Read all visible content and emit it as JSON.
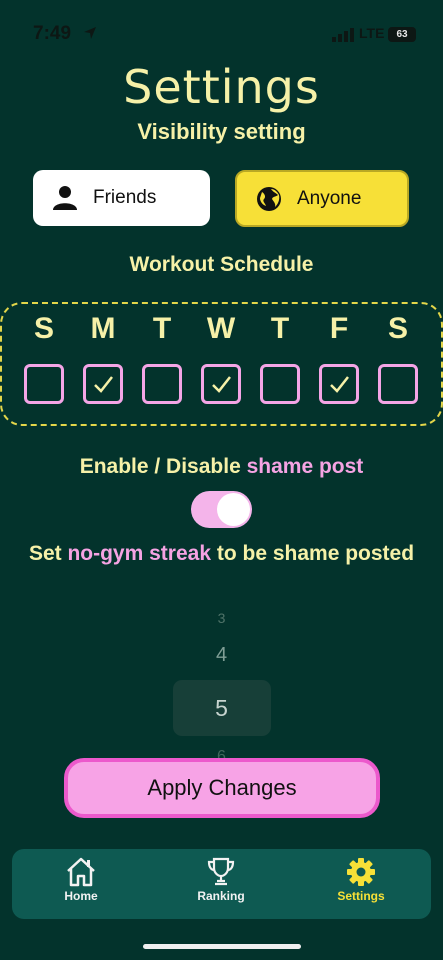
{
  "status": {
    "time": "7:49",
    "network": "LTE",
    "battery": "63"
  },
  "header": {
    "title": "Settings",
    "subtitle": "Visibility setting"
  },
  "visibility": {
    "friends_label": "Friends",
    "anyone_label": "Anyone",
    "selected": "Anyone",
    "friends_icon": "person-icon",
    "anyone_icon": "globe-icon"
  },
  "schedule": {
    "title": "Workout Schedule",
    "days": [
      {
        "letter": "S",
        "checked": false
      },
      {
        "letter": "M",
        "checked": true
      },
      {
        "letter": "T",
        "checked": false
      },
      {
        "letter": "W",
        "checked": true
      },
      {
        "letter": "T",
        "checked": false
      },
      {
        "letter": "F",
        "checked": true
      },
      {
        "letter": "S",
        "checked": false
      }
    ]
  },
  "shame": {
    "enable_prefix": "Enable / Disable ",
    "enable_highlight": "shame post",
    "enabled": true,
    "streak_prefix": "Set ",
    "streak_highlight": "no-gym streak",
    "streak_suffix": " to be shame posted"
  },
  "picker": {
    "values": [
      "3",
      "4",
      "5",
      "6"
    ],
    "selected": "5"
  },
  "apply_label": "Apply Changes",
  "tabs": [
    {
      "label": "Home",
      "icon": "house-icon",
      "active": false
    },
    {
      "label": "Ranking",
      "icon": "trophy-icon",
      "active": false
    },
    {
      "label": "Settings",
      "icon": "gear-icon",
      "active": true
    }
  ],
  "colors": {
    "background": "#03332c",
    "accent_yellow": "#f7e037",
    "accent_pink": "#f5a3e3",
    "text": "#f6f1a8"
  }
}
